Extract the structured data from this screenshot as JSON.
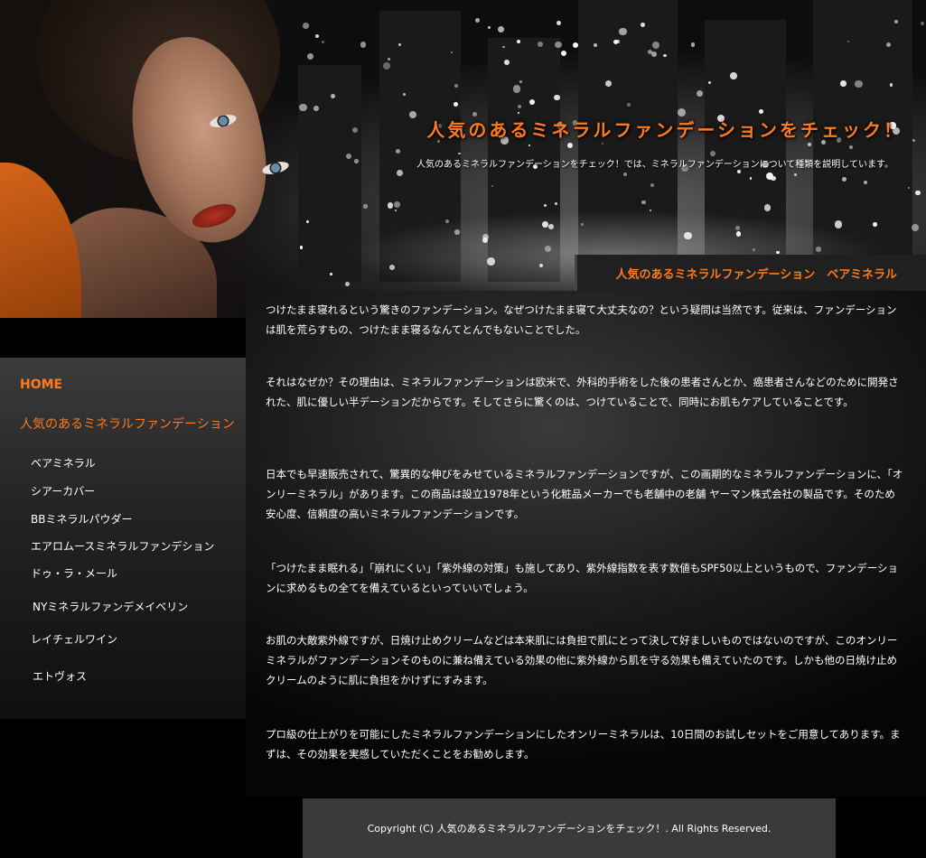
{
  "header": {
    "site_title": "人気のあるミネラルファンデーションをチェック！",
    "site_description": "人気のあるミネラルファンデーションをチェック！では、ミネラルファンデーションについて種類を説明しています。"
  },
  "page_heading": "人気のあるミネラルファンデーション　ベアミネラル",
  "sidebar": {
    "home": "HOME",
    "category": "人気のあるミネラルファンデーション",
    "items": [
      "ベアミネラル",
      "シアーカバー",
      "BBミネラルパウダー",
      "エアロムースミネラルファンデション",
      "ドゥ・ラ・メール",
      "NYミネラルファンデメイベリン",
      "レイチェルワイン",
      "エトヴォス"
    ]
  },
  "content": {
    "paragraphs": [
      "つけたまま寝れるという驚きのファンデーション。なぜつけたまま寝て大丈夫なの？という疑問は当然です。従来は、ファンデーションは肌を荒らすもの、つけたまま寝るなんてとんでもないことでした。",
      "それはなぜか？その理由は、ミネラルファンデーションは欧米で、外科的手術をした後の患者さんとか、癌患者さんなどのために開発された、肌に優しい半デーションだからです。そしてさらに驚くのは、つけていることで、同時にお肌もケアしていることです。",
      "日本でも早速販売されて、驚異的な伸びをみせているミネラルファンデーションですが、この画期的なミネラルファンデーションに、「オンリーミネラル」があります。この商品は設立1978年という化粧品メーカーでも老舗中の老舗 ヤーマン株式会社の製品です。そのため安心度、信頼度の高いミネラルファンデーションです。",
      "「つけたまま眠れる」「崩れにくい」「紫外線の対策」も施してあり、紫外線指数を表す数値もSPF50以上というもので、ファンデーションに求めるもの全てを備えているといっていいでしょう。",
      "お肌の大敵紫外線ですが、日焼け止めクリームなどは本来肌には負担で肌にとって決して好ましいものではないのですが、このオンリーミネラルがファンデーションそのものに兼ね備えている効果の他に紫外線から肌を守る効果も備えていたのです。しかも他の日焼け止めクリームのように肌に負担をかけずにすみます。",
      "プロ級の仕上がりを可能にしたミネラルファンデーションにしたオンリーミネラルは、10日間のお試しセットをご用意してあります。まずは、その効果を実感していただくことをお勧めします。"
    ]
  },
  "footer": {
    "copyright": "Copyright (C) 人気のあるミネラルファンデーションをチェック！.  All Rights Reserved."
  },
  "colors": {
    "accent": "#ff7a1f",
    "background": "#000000",
    "footer_bg": "#3a3a3a"
  }
}
